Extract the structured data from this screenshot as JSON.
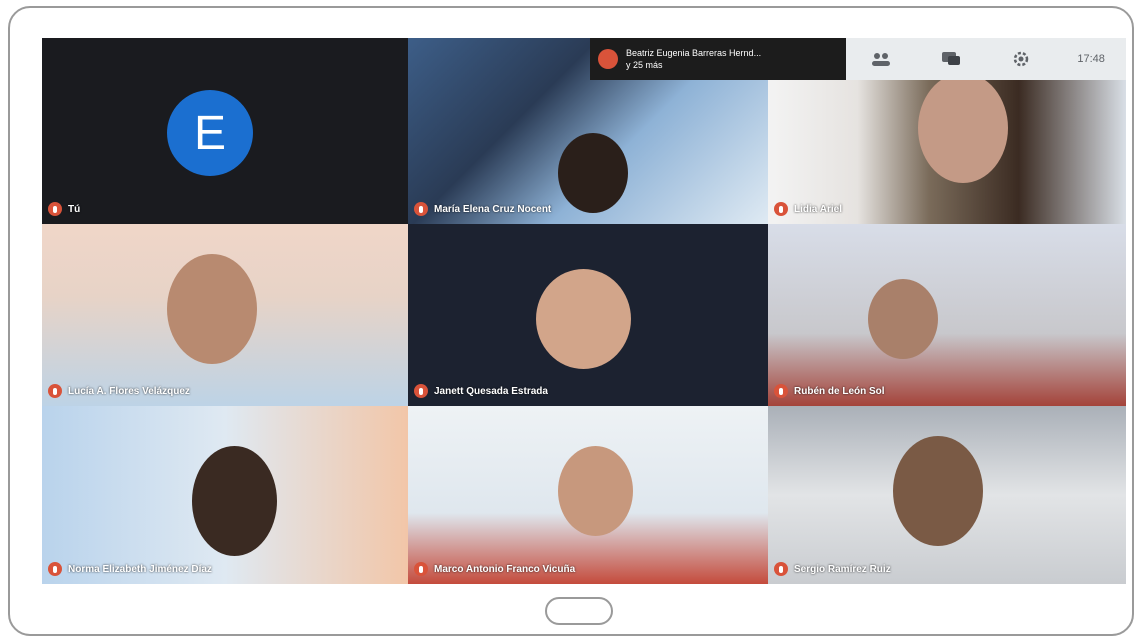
{
  "topbar": {
    "presenter_name": "Beatriz Eugenia Barreras Hernd...",
    "presenter_status": "y 25 más",
    "clock": "17:48",
    "icons": [
      "people-icon",
      "chat-icon",
      "gear-icon"
    ]
  },
  "tiles": [
    {
      "name": "Tú",
      "avatar_letter": "E"
    },
    {
      "name": "María Elena Cruz Nocent"
    },
    {
      "name": "Lidia Ariel"
    },
    {
      "name": "Lucía A. Flores Velázquez"
    },
    {
      "name": "Janett Quesada Estrada"
    },
    {
      "name": "Rubén de León Sol"
    },
    {
      "name": "Norma Elizabeth Jiménez Díaz"
    },
    {
      "name": "Marco Antonio Franco Vicuña"
    },
    {
      "name": "Sergio Ramírez Ruiz"
    }
  ],
  "colors": {
    "accent_mic": "#d9533a",
    "avatar_bg": "#1b6fd0",
    "topbar_bg": "#e9ecee"
  }
}
